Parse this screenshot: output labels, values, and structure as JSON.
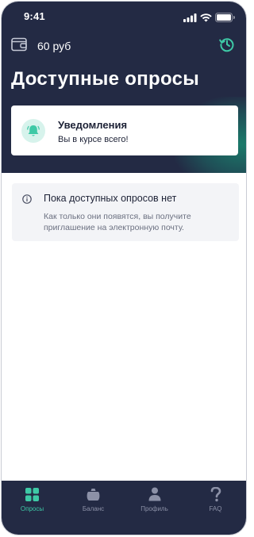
{
  "status_bar": {
    "time": "9:41"
  },
  "header": {
    "balance": "60 руб",
    "title": "Доступные опросы"
  },
  "notification_card": {
    "title": "Уведомления",
    "subtitle": "Вы в курсе всего!"
  },
  "empty_state": {
    "title": "Пока доступных опросов нет",
    "text": "Как только они появятся, вы получите приглашение на электронную почту."
  },
  "tabbar": {
    "items": [
      {
        "label": "Опросы",
        "icon": "grid-icon",
        "active": true
      },
      {
        "label": "Баланс",
        "icon": "wallet-bag-icon",
        "active": false
      },
      {
        "label": "Профиль",
        "icon": "person-icon",
        "active": false
      },
      {
        "label": "FAQ",
        "icon": "question-icon",
        "active": false
      }
    ]
  },
  "colors": {
    "header_bg": "#232a44",
    "accent": "#3ec9a6",
    "tab_inactive": "#8c91a7",
    "card_bg": "#ffffff",
    "info_bg": "#f3f4f7"
  }
}
